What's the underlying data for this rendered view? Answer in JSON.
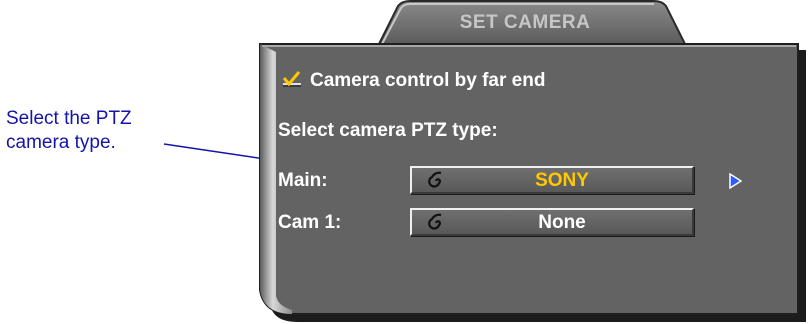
{
  "annotation": {
    "line1": "Select the PTZ",
    "line2": "camera type."
  },
  "panel": {
    "title": "SET CAMERA",
    "far_end_control": {
      "label": "Camera control by far end",
      "checked": true
    },
    "ptz_heading": "Select camera PTZ type:",
    "rows": [
      {
        "label": "Main:",
        "value": "SONY",
        "active": true
      },
      {
        "label": "Cam 1:",
        "value": "None",
        "active": false
      }
    ]
  },
  "colors": {
    "annotation": "#1414a8",
    "active_value": "#ffc800",
    "panel_face": "#636363"
  },
  "icons": {
    "selector_icon": "spiral-icon",
    "nav_arrow": "right-arrow-icon",
    "check": "check-icon"
  }
}
